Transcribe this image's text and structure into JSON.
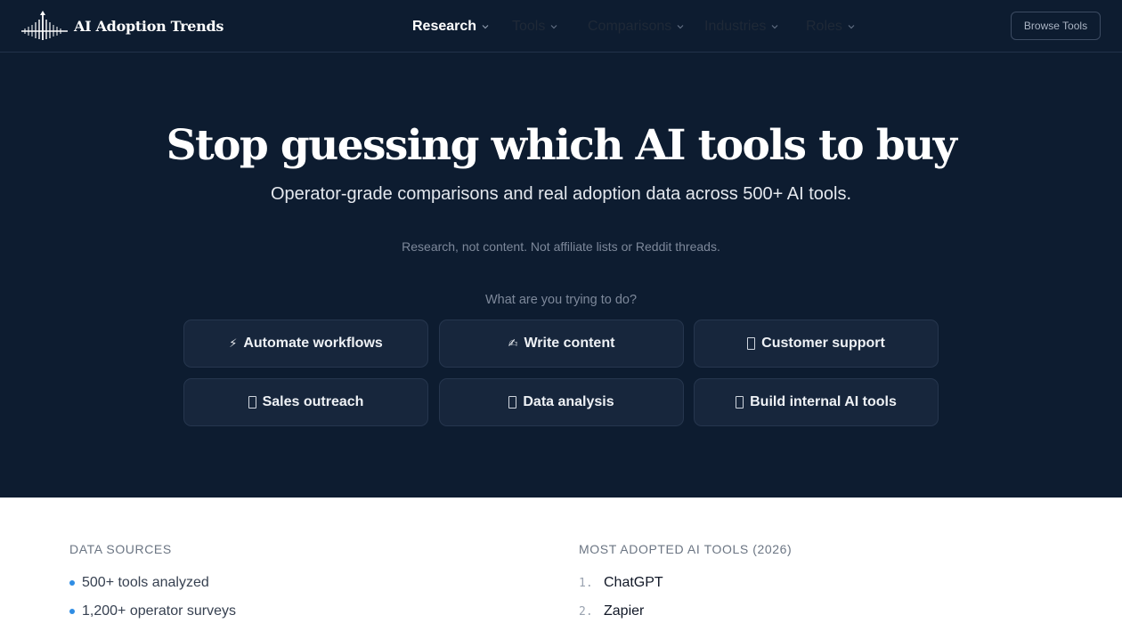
{
  "header": {
    "brand": "AI Adoption Trends",
    "nav": [
      {
        "label": "Research",
        "active": true
      },
      {
        "label": "Tools",
        "active": false
      },
      {
        "label": "Comparisons",
        "active": false
      },
      {
        "label": "Industries",
        "active": false
      },
      {
        "label": "Roles",
        "active": false
      }
    ],
    "browse_label": "Browse Tools"
  },
  "hero": {
    "title": "Stop guessing which AI tools to buy",
    "subtitle": "Operator-grade comparisons and real adoption data across 500+ AI tools.",
    "note": "Research, not content. Not affiliate lists or Reddit threads.",
    "prompt": "What are you trying to do?",
    "goals": [
      {
        "icon": "lightning-icon",
        "glyph": "⚡",
        "label": "Automate workflows"
      },
      {
        "icon": "writing-hand-icon",
        "glyph": "✍",
        "label": "Write content"
      },
      {
        "icon": "headset-icon",
        "glyph": "",
        "label": "Customer support"
      },
      {
        "icon": "mail-icon",
        "glyph": "",
        "label": "Sales outreach"
      },
      {
        "icon": "chart-icon",
        "glyph": "",
        "label": "Data analysis"
      },
      {
        "icon": "tools-icon",
        "glyph": "",
        "label": "Build internal AI tools"
      }
    ]
  },
  "data_sources": {
    "heading": "DATA SOURCES",
    "items": [
      "500+ tools analyzed",
      "1,200+ operator surveys"
    ]
  },
  "most_adopted": {
    "heading": "MOST ADOPTED AI TOOLS (2026)",
    "items": [
      {
        "rank": "1.",
        "name": "ChatGPT"
      },
      {
        "rank": "2.",
        "name": "Zapier"
      }
    ]
  },
  "colors": {
    "navy": "#0d1c30",
    "card": "#17263c",
    "accent_dot": "#2f8de4"
  }
}
